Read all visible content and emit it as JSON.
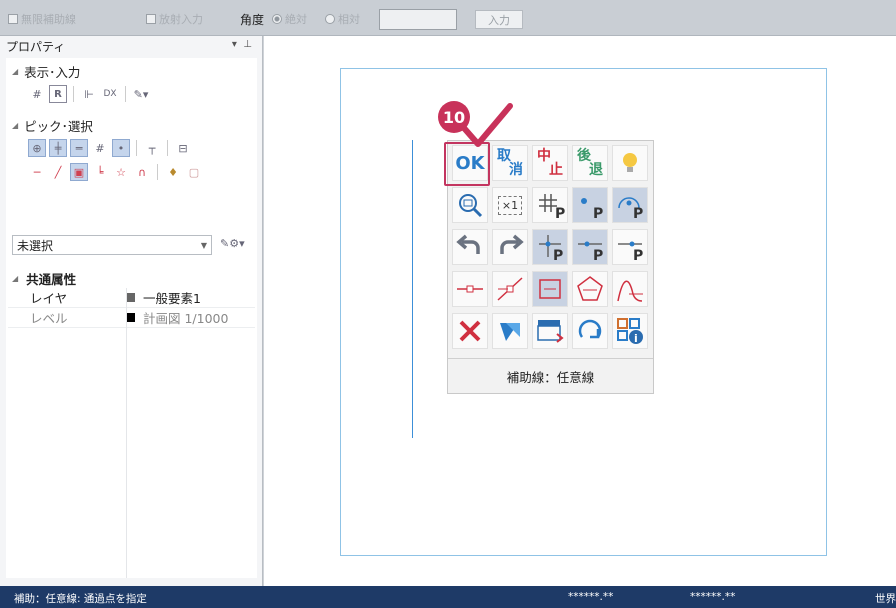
{
  "topbar": {
    "infinite_aux_line_label": "無限補助線",
    "radial_input_label": "放射入力",
    "angle_label": "角度",
    "absolute_label": "絶対",
    "relative_label": "相対",
    "angle_value": "",
    "enter_button_label": "入力"
  },
  "panel": {
    "title": "プロパティ",
    "section_display": "表示･入力",
    "section_pick": "ピック･選択",
    "selection_value": "未選択",
    "common_props_title": "共通属性",
    "props": [
      {
        "key": "レイヤ",
        "value": "一般要素1",
        "swatch": "#666666"
      },
      {
        "key": "レベル",
        "value": "計画図 1/1000",
        "swatch": "#000000"
      }
    ]
  },
  "palette": {
    "ok_label": "OK",
    "cancel_label_top": "取",
    "cancel_label_bottom": "消",
    "abort_label_top": "中",
    "abort_label_bottom": "止",
    "back_label_top": "後",
    "back_label_bottom": "退",
    "zoom_fit_label": "×1",
    "status_text": "補助線：任意線",
    "step_badge": "10"
  },
  "statusbar": {
    "message": "補助：任意線: 通過点を指定",
    "coord_x": "******.**",
    "coord_y": "******.**",
    "coord_system": "世界"
  },
  "colors": {
    "accent_red": "#c8325a",
    "status_bg": "#1e3a67",
    "sheet_border": "#8fc3e6"
  }
}
